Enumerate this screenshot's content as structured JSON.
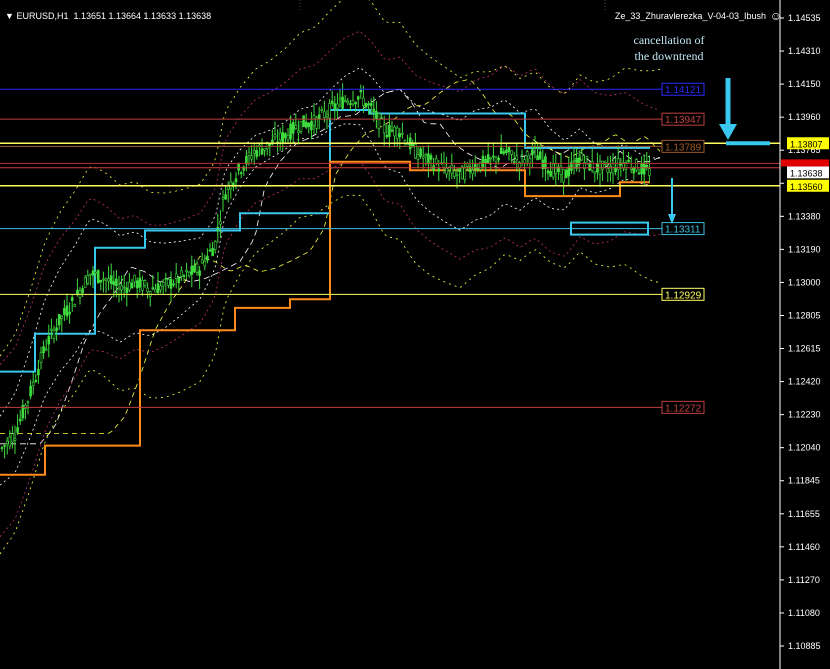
{
  "header": {
    "symbol": "EURUSD,H1",
    "ohlc": "1.13651 1.13664 1.13633 1.13638",
    "indicator": "Ze_33_Zhuravlerezka_V-04-03_Ibush"
  },
  "annotation": {
    "line1": "cancellation of",
    "line2": "the downtrend"
  },
  "colors": {
    "background": "#000000",
    "candles": "#3fdc3f",
    "blue_level": "#2a2aff",
    "red_level": "#b83030",
    "yellow_level": "#ffff60",
    "cyan": "#38c8f0",
    "orange": "#ff8c1a"
  },
  "chart_data": {
    "type": "candlestick",
    "symbol": "EURUSD",
    "timeframe": "H1",
    "y_axis_ticks": [
      "1.14535",
      "1.14310",
      "1.14150",
      "1.13960",
      "1.13765",
      "1.13580",
      "1.13380",
      "1.13190",
      "1.13000",
      "1.12805",
      "1.12615",
      "1.12420",
      "1.12230",
      "1.12040",
      "1.11845",
      "1.11655",
      "1.11460",
      "1.11270",
      "1.11080",
      "1.10885"
    ],
    "ylim": [
      1.10885,
      1.14535
    ],
    "price_tags": [
      {
        "value": "1.13807",
        "color": "#ffff00"
      },
      {
        "value": "1.13638",
        "color": "#ffffff"
      },
      {
        "value": "1.13560",
        "color": "#ffff00"
      }
    ],
    "levels": [
      {
        "label": "1.14121",
        "price": 1.14121,
        "color": "#2a2aff"
      },
      {
        "label": "1.13947",
        "price": 1.13947,
        "color": "#c04040"
      },
      {
        "label": "1.13789",
        "price": 1.13789,
        "color": "#a05a2a"
      },
      {
        "label": "1.13311",
        "price": 1.13311,
        "color": "#40c0e0"
      },
      {
        "label": "1.12929",
        "price": 1.12929,
        "color": "#ffff60"
      },
      {
        "label": "1.12272",
        "price": 1.12272,
        "color": "#c04040"
      }
    ],
    "extra_lines": [
      1.13807,
      1.1356,
      1.1369,
      1.13665
    ]
  }
}
